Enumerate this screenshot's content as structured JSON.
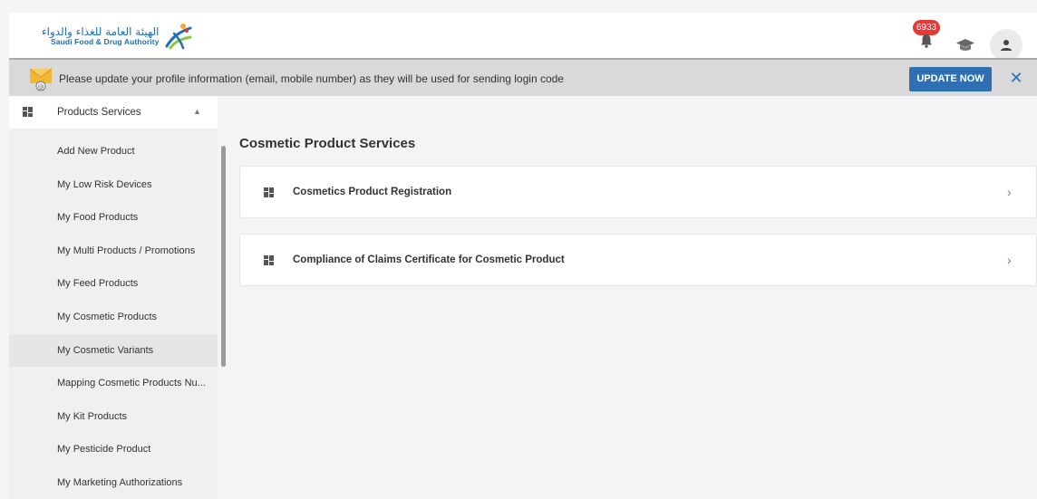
{
  "header": {
    "logo_arabic": "الهيئة العامة للغذاء والدواء",
    "logo_english": "Saudi Food & Drug Authority",
    "notification_count": "6933",
    "icons": [
      "bell-icon",
      "graduation-cap-icon",
      "user-icon"
    ]
  },
  "banner": {
    "message": "Please update your profile information (email, mobile number) as they will be used for sending login code",
    "update_label": "UPDATE NOW",
    "close_label": "✕",
    "accent_color": "#2f6fb4"
  },
  "sidebar": {
    "section_label": "Products Services",
    "items": [
      {
        "label": "Add New Product"
      },
      {
        "label": "My Low Risk Devices"
      },
      {
        "label": "My Food Products"
      },
      {
        "label": "My Multi Products / Promotions"
      },
      {
        "label": "My Feed Products"
      },
      {
        "label": "My Cosmetic Products"
      },
      {
        "label": "My Cosmetic Variants",
        "active": true
      },
      {
        "label": "Mapping Cosmetic Products Nu..."
      },
      {
        "label": "My Kit Products"
      },
      {
        "label": "My Pesticide Product"
      },
      {
        "label": "My Marketing Authorizations"
      }
    ]
  },
  "main": {
    "title": "Cosmetic Product Services",
    "services": [
      {
        "label": "Cosmetics Product Registration"
      },
      {
        "label": "Compliance of Claims Certificate for Cosmetic Product"
      }
    ]
  }
}
